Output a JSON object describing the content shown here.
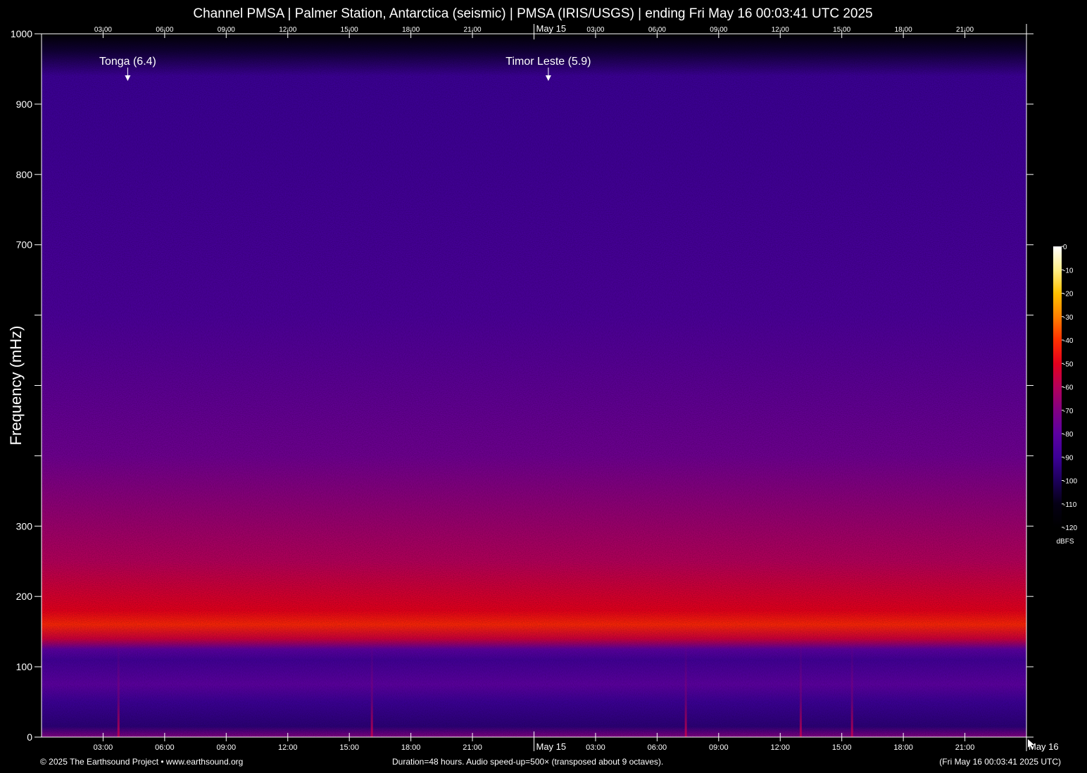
{
  "chart_data": {
    "type": "heatmap",
    "title": "Channel PMSA | Palmer Station, Antarctica (seismic) | PMSA (IRIS/USGS) | ending Fri May 16 00:03:41 UTC 2025",
    "xlabel": "",
    "ylabel": "Frequency (mHz)",
    "ylim": [
      0,
      1000
    ],
    "y_ticks": [
      0,
      100,
      200,
      300,
      400,
      500,
      600,
      700,
      800,
      900,
      1000
    ],
    "y_tick_labels": [
      "0",
      "100",
      "200",
      "300",
      "",
      "",
      "",
      "700",
      "800",
      "900",
      "1000"
    ],
    "x_range_hours": [
      0,
      48
    ],
    "x_ticks": [
      {
        "hour": 3,
        "label": "03:00"
      },
      {
        "hour": 6,
        "label": "06:00"
      },
      {
        "hour": 9,
        "label": "09:00"
      },
      {
        "hour": 12,
        "label": "12:00"
      },
      {
        "hour": 15,
        "label": "15:00"
      },
      {
        "hour": 18,
        "label": "18:00"
      },
      {
        "hour": 21,
        "label": "21:00"
      },
      {
        "hour": 24,
        "label": "May 15"
      },
      {
        "hour": 27,
        "label": "03:00"
      },
      {
        "hour": 30,
        "label": "06:00"
      },
      {
        "hour": 33,
        "label": "09:00"
      },
      {
        "hour": 36,
        "label": "12:00"
      },
      {
        "hour": 39,
        "label": "15:00"
      },
      {
        "hour": 42,
        "label": "18:00"
      },
      {
        "hour": 45,
        "label": "21:00"
      },
      {
        "hour": 48,
        "label": "May 16"
      }
    ],
    "colorbar": {
      "label": "dBFS",
      "range": [
        -120,
        0
      ],
      "ticks": [
        "0",
        "-10",
        "-20",
        "-30",
        "-40",
        "-50",
        "-60",
        "-70",
        "-80",
        "-90",
        "-100",
        "-110",
        "-120"
      ],
      "colors": [
        "#ffffff",
        "#ffee88",
        "#ffc000",
        "#ff8000",
        "#ff3000",
        "#e4001c",
        "#b4005a",
        "#820082",
        "#5c00a0",
        "#3c0096",
        "#1c005a",
        "#050014",
        "#000000"
      ]
    },
    "spectrum_profile": [
      {
        "freq": 0,
        "level": -70
      },
      {
        "freq": 15,
        "level": -95
      },
      {
        "freq": 50,
        "level": -90
      },
      {
        "freq": 75,
        "level": -80
      },
      {
        "freq": 110,
        "level": -88
      },
      {
        "freq": 125,
        "level": -80
      },
      {
        "freq": 140,
        "level": -55
      },
      {
        "freq": 160,
        "level": -42
      },
      {
        "freq": 180,
        "level": -50
      },
      {
        "freq": 250,
        "level": -60
      },
      {
        "freq": 400,
        "level": -75
      },
      {
        "freq": 600,
        "level": -85
      },
      {
        "freq": 800,
        "level": -88
      },
      {
        "freq": 940,
        "level": -90
      },
      {
        "freq": 975,
        "level": -105
      },
      {
        "freq": 1000,
        "level": -118
      }
    ],
    "transient_lines_hours": [
      3.75,
      16.1,
      31.4,
      37.0,
      39.5
    ],
    "annotations": [
      {
        "label": "Tonga (6.4)",
        "hour": 4.2
      },
      {
        "label": "Timor Leste (5.9)",
        "hour": 24.7
      }
    ]
  },
  "footer": {
    "left": "© 2025 The Earthsound Project • www.earthsound.org",
    "center": "Duration=48 hours. Audio speed-up=500× (transposed about 9 octaves).",
    "right": "(Fri May 16 00:03:41 2025 UTC)"
  }
}
